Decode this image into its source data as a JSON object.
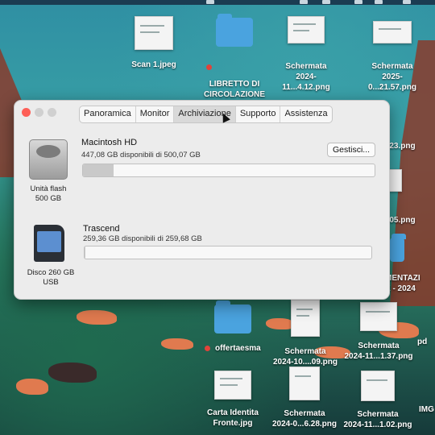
{
  "window": {
    "tabs": [
      {
        "label": "Panoramica",
        "active": false
      },
      {
        "label": "Monitor",
        "active": false
      },
      {
        "label": "Archiviazione",
        "active": true
      },
      {
        "label": "Supporto",
        "active": false
      },
      {
        "label": "Assistenza",
        "active": false
      }
    ],
    "disks": [
      {
        "icon": "internal-disk-icon",
        "caption": "Unità flash\n500 GB",
        "name": "Macintosh HD",
        "detail": "447,08 GB disponibili di 500,07 GB",
        "used_fraction": 0.106,
        "manage_label": "Gestisci..."
      },
      {
        "icon": "sd-card-icon",
        "caption": "Disco 260 GB\nUSB",
        "name": "Trascend",
        "detail": "259,36 GB disponibili di 259,68 GB",
        "used_fraction": 0.0012
      }
    ]
  },
  "desktop": {
    "items": [
      {
        "label": "Scan 1.jpeg"
      },
      {
        "label": "LIBRETTO DI\nCIRCOLAZIONE",
        "tag": "red"
      },
      {
        "label": "Schermata\n2024-11...4.12.png"
      },
      {
        "label": "Schermata\n2025-0...21.57.png"
      },
      {
        "label": "offertaesma",
        "tag": "red"
      },
      {
        "label": "Schermata\n2024-10....09.png"
      },
      {
        "label": "Schermata\n2024-11...1.37.png"
      },
      {
        "label": "Carta Identita\nFronte.jpg"
      },
      {
        "label": "Schermata\n2024-0...6.28.png"
      },
      {
        "label": "Schermata\n2024-11...1.02.png"
      },
      {
        "label": "9.23.png"
      },
      {
        "label": "0.05.png"
      },
      {
        "label": "MENTAZI\nE - 2024"
      },
      {
        "label": "pd"
      },
      {
        "label": "IMG"
      }
    ]
  },
  "colors": {
    "tag_red": "#e0433a",
    "folder_blue": "#4aa3df",
    "close_red": "#fe5f57"
  }
}
